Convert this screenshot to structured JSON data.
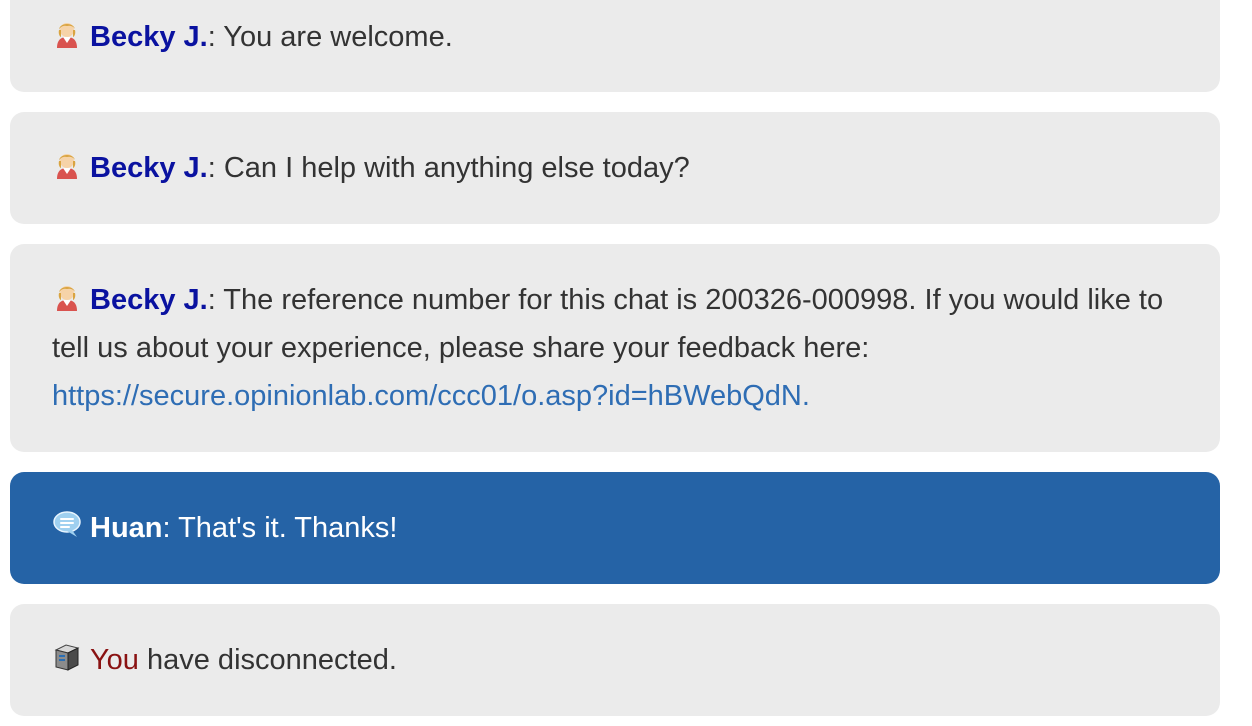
{
  "messages": [
    {
      "sender": "Becky J.",
      "separator": ": ",
      "text": "You are welcome.",
      "icon": "agent-avatar-icon"
    },
    {
      "sender": "Becky J.",
      "separator": ": ",
      "text": "Can I help with anything else today?",
      "icon": "agent-avatar-icon"
    },
    {
      "sender": "Becky J.",
      "separator": ": ",
      "text": "The reference number for this chat is 200326-000998. If you would like to tell us about your experience, please share your feedback here: ",
      "link": "https://secure.opinionlab.com/ccc01/o.asp?id=hBWebQdN.",
      "icon": "agent-avatar-icon"
    },
    {
      "sender": "Huan",
      "separator": ": ",
      "text": "That's it. Thanks!",
      "icon": "speech-bubble-icon"
    },
    {
      "sender": "You",
      "text": " have disconnected.",
      "icon": "disconnect-icon"
    }
  ],
  "colors": {
    "agent_name": "#0a12a0",
    "agent_bubble": "#ebebeb",
    "self_bubble": "#2563a6",
    "link": "#2e6db4",
    "system_you": "#8a1212"
  }
}
